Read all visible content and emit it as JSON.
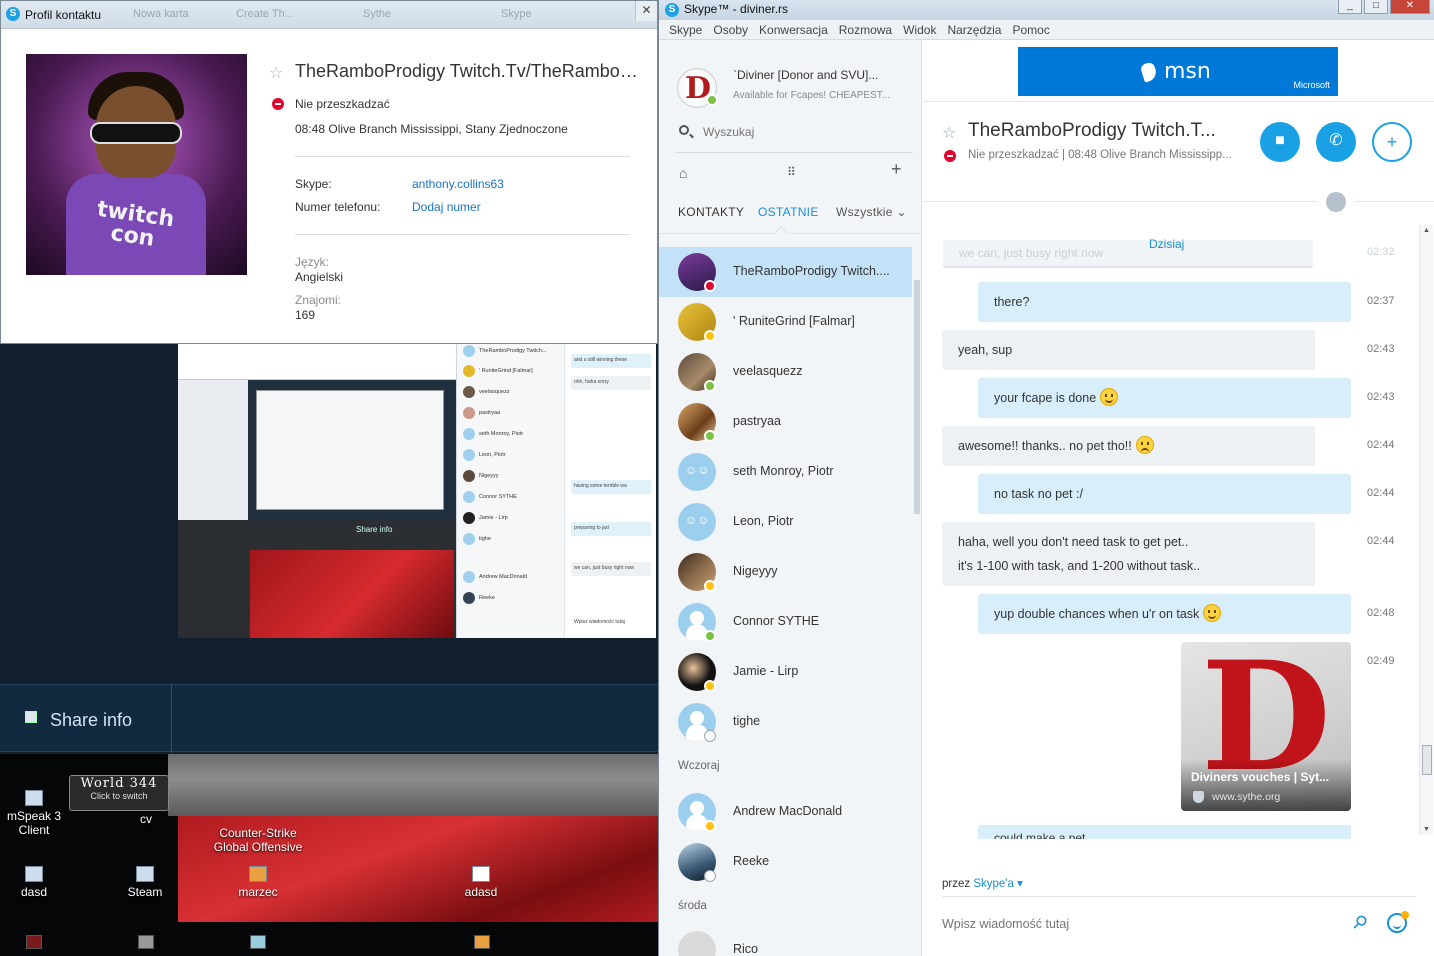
{
  "profile": {
    "window_title": "Profil kontaktu",
    "ghost_tabs": [
      "Nowa karta",
      "Create Th...",
      "Sythe",
      "Skype"
    ],
    "avatar_logo": "twitch con",
    "name": "TheRamboProdigy Twitch.Tv/TheRamboPr...",
    "status": "Nie przeszkadzać",
    "local_time_location": "08:48 Olive Branch Mississippi, Stany Zjednoczone",
    "skype_label": "Skype:",
    "skype_value": "anthony.collins63",
    "phone_label": "Numer telefonu:",
    "phone_value": "Dodaj numer",
    "language_label": "Język:",
    "language_value": "Angielski",
    "friends_label": "Znajomi:",
    "friends_value": "169"
  },
  "desktop": {
    "share_info": "Share info",
    "share_info_small": "Share info",
    "world_badge": {
      "title": "World 344",
      "subtitle": "Click to switch"
    },
    "icons": [
      {
        "label": "mSpeak 3 Client"
      },
      {
        "label": "cv"
      },
      {
        "label": "Counter-Strike\nGlobal Offensive"
      },
      {
        "label": "dasd"
      },
      {
        "label": "Steam"
      },
      {
        "label": "marzec"
      },
      {
        "label": "adasd"
      }
    ],
    "thumb_contacts": [
      "TheRamboProdigy Twitch...",
      "' RuniteGrind [Falmar]",
      "veelasquezz",
      "pastryaa",
      "seth Monroy, Piotr",
      "Leon, Piotr",
      "Nigeyyy",
      "Connor SYTHE",
      "Jamie - Lirp",
      "tighe",
      "Andrew MacDonald",
      "Reeke"
    ],
    "thumb_msgs": [
      "and u still winning these",
      "ohh, haha sorry.",
      "having some terrible wa",
      "preparing to jad",
      "we can, just busy right now",
      "Wpisz wiadomość tutaj"
    ]
  },
  "skype": {
    "window_title": "Skype™ - diviner.rs",
    "menu": [
      "Skype",
      "Osoby",
      "Konwersacja",
      "Rozmowa",
      "Widok",
      "Narzędzia",
      "Pomoc"
    ],
    "me": {
      "name": "`Diviner [Donor and SVU]...",
      "mood": "Available for Fcapes! CHEAPEST..."
    },
    "search_placeholder": "Wyszukaj",
    "tabs": {
      "contacts": "KONTAKTY",
      "recent": "OSTATNIE",
      "filter": "Wszystkie"
    },
    "contacts": [
      {
        "name": "TheRamboProdigy Twitch....",
        "status": "dnd",
        "selected": true
      },
      {
        "name": "' RuniteGrind [Falmar]",
        "status": "away"
      },
      {
        "name": "veelasquezz",
        "status": "on"
      },
      {
        "name": "pastryaa",
        "status": "on"
      },
      {
        "name": "seth Monroy, Piotr",
        "status": "group"
      },
      {
        "name": "Leon, Piotr",
        "status": "group"
      },
      {
        "name": "Nigeyyy",
        "status": "away"
      },
      {
        "name": "Connor SYTHE",
        "status": "on"
      },
      {
        "name": "Jamie - Lirp",
        "status": "away"
      },
      {
        "name": "tighe",
        "status": "off"
      }
    ],
    "day_yesterday": "Wczoraj",
    "contacts_yesterday": [
      {
        "name": "Andrew MacDonald",
        "status": "away"
      },
      {
        "name": "Reeke",
        "status": "off"
      }
    ],
    "day_wednesday": "środa",
    "contacts_wednesday": [
      {
        "name": "Rico",
        "status": "off"
      }
    ],
    "ad": {
      "text": "msn",
      "brand": "Microsoft"
    },
    "conversation": {
      "name": "TheRamboProdigy Twitch.T...",
      "status_line": "Nie przeszkadzać  |  08:48 Olive Branch Mississipp...",
      "today": "Dzisiaj",
      "ghost_message": "we can, just busy right now",
      "ghost_time": "02:32",
      "messages": [
        {
          "dir": "out",
          "text": "there?",
          "time": "02:37"
        },
        {
          "dir": "in",
          "text": "yeah, sup",
          "time": "02:43"
        },
        {
          "dir": "out",
          "text": "your fcape is done",
          "emoji": "happy",
          "time": "02:43"
        },
        {
          "dir": "in",
          "text": "awesome!! thanks.. no pet tho!!",
          "emoji": "sad",
          "time": "02:44"
        },
        {
          "dir": "out",
          "text": "no task no pet :/",
          "time": "02:44"
        },
        {
          "dir": "in",
          "text": "haha, well you don't need task to get pet..",
          "text2": "it's 1-100 with task, and 1-200 without task..",
          "time": "02:44"
        },
        {
          "dir": "out",
          "text": "yup double chances when u'r on task",
          "emoji": "happy",
          "time": "02:48"
        }
      ],
      "card": {
        "title": "Diviners vouches | Syt...",
        "url": "www.sythe.org",
        "time": "02:49"
      },
      "partial_message": "could make a pet",
      "via_prefix": "przez",
      "via_link": "Skype'a",
      "compose_placeholder": "Wpisz wiadomość tutaj"
    }
  }
}
